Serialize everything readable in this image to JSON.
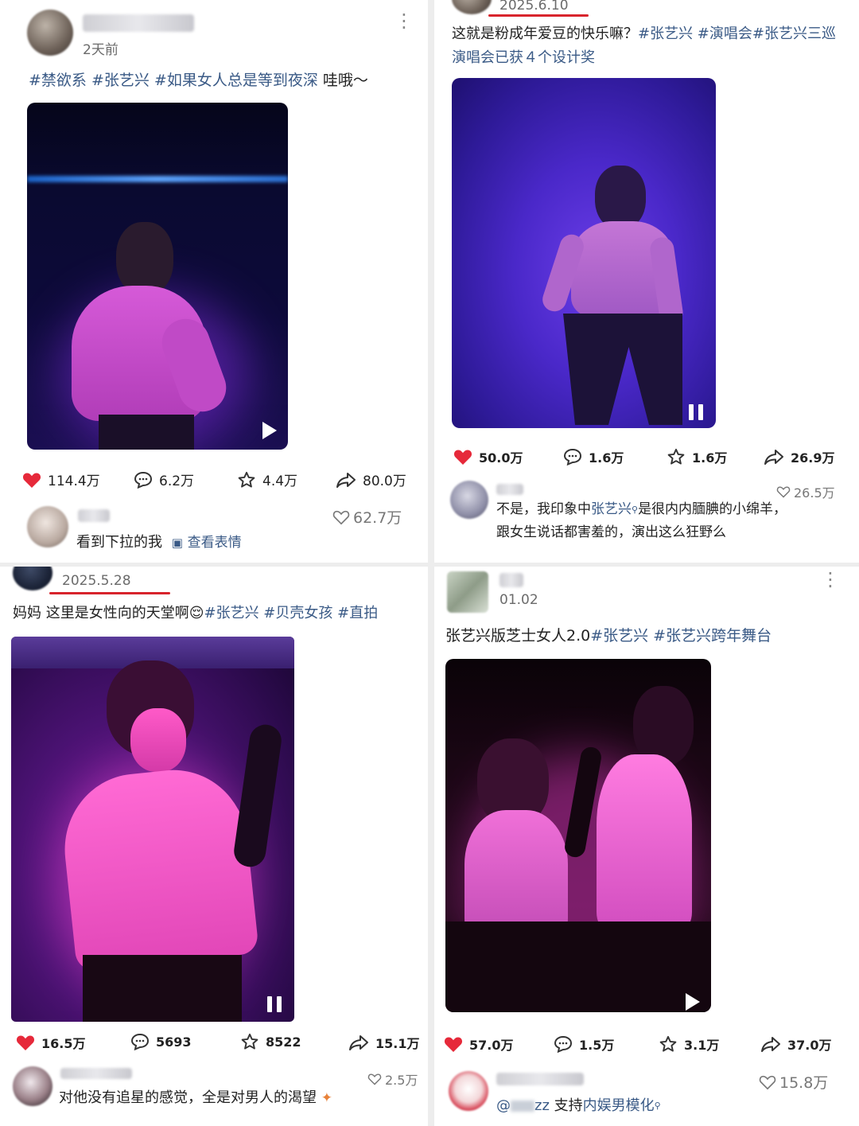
{
  "colors": {
    "hashtag": "#3a5a86",
    "like_red": "#e6293a",
    "underline_red": "#d8242c",
    "stage_purple": "#3a1fb8",
    "stage_pink": "#e040c8"
  },
  "posts": [
    {
      "time": "2天前",
      "caption_tags": "#禁欲系 #张艺兴 #如果女人总是等到夜深",
      "caption_text": " 哇哦～",
      "media_control": "play-icon",
      "likes": "114.4万",
      "comments": "6.2万",
      "favorites": "4.4万",
      "shares": "80.0万",
      "top_comment": {
        "text": "看到下拉的我",
        "link": "查看表情",
        "likes": "62.7万"
      }
    },
    {
      "time": "2025.6.10",
      "caption_text": "这就是粉成年爱豆的快乐嘛？",
      "caption_tags": "#张艺兴 #演唱会#张艺兴三巡演唱会已获４个设计奖",
      "media_control": "pause-icon",
      "likes": "50.0万",
      "comments": "1.6万",
      "favorites": "1.6万",
      "shares": "26.9万",
      "top_comment": {
        "text_before": "不是，我印象中",
        "mention": "张艺兴",
        "text_after": "是很内内腼腆的小绵羊，",
        "text_line2": "跟女生说话都害羞的，演出这么狂野么",
        "likes": "26.5万"
      }
    },
    {
      "time": "2025.5.28",
      "caption_text": "妈妈 这里是女性向的天堂啊",
      "caption_emoji": "😌",
      "caption_tags": "#张艺兴 #贝壳女孩 #直拍",
      "media_control": "pause-icon",
      "likes": "16.5万",
      "comments": "5693",
      "favorites": "8522",
      "shares": "15.1万",
      "top_comment": {
        "text": "对他没有追星的感觉，全是对男人的渴望",
        "likes": "2.5万"
      }
    },
    {
      "time": "01.02",
      "caption_text": "张艺兴版芝士女人2.0",
      "caption_tags": "#张艺兴 #张艺兴跨年舞台",
      "media_control": "play-icon",
      "likes": "57.0万",
      "comments": "1.5万",
      "favorites": "3.1万",
      "shares": "37.0万",
      "top_comment": {
        "prefix": "@",
        "prefix_tail": "zz",
        "text_before": " 支持",
        "mention": "内娱男模化",
        "likes": "15.8万"
      }
    }
  ]
}
